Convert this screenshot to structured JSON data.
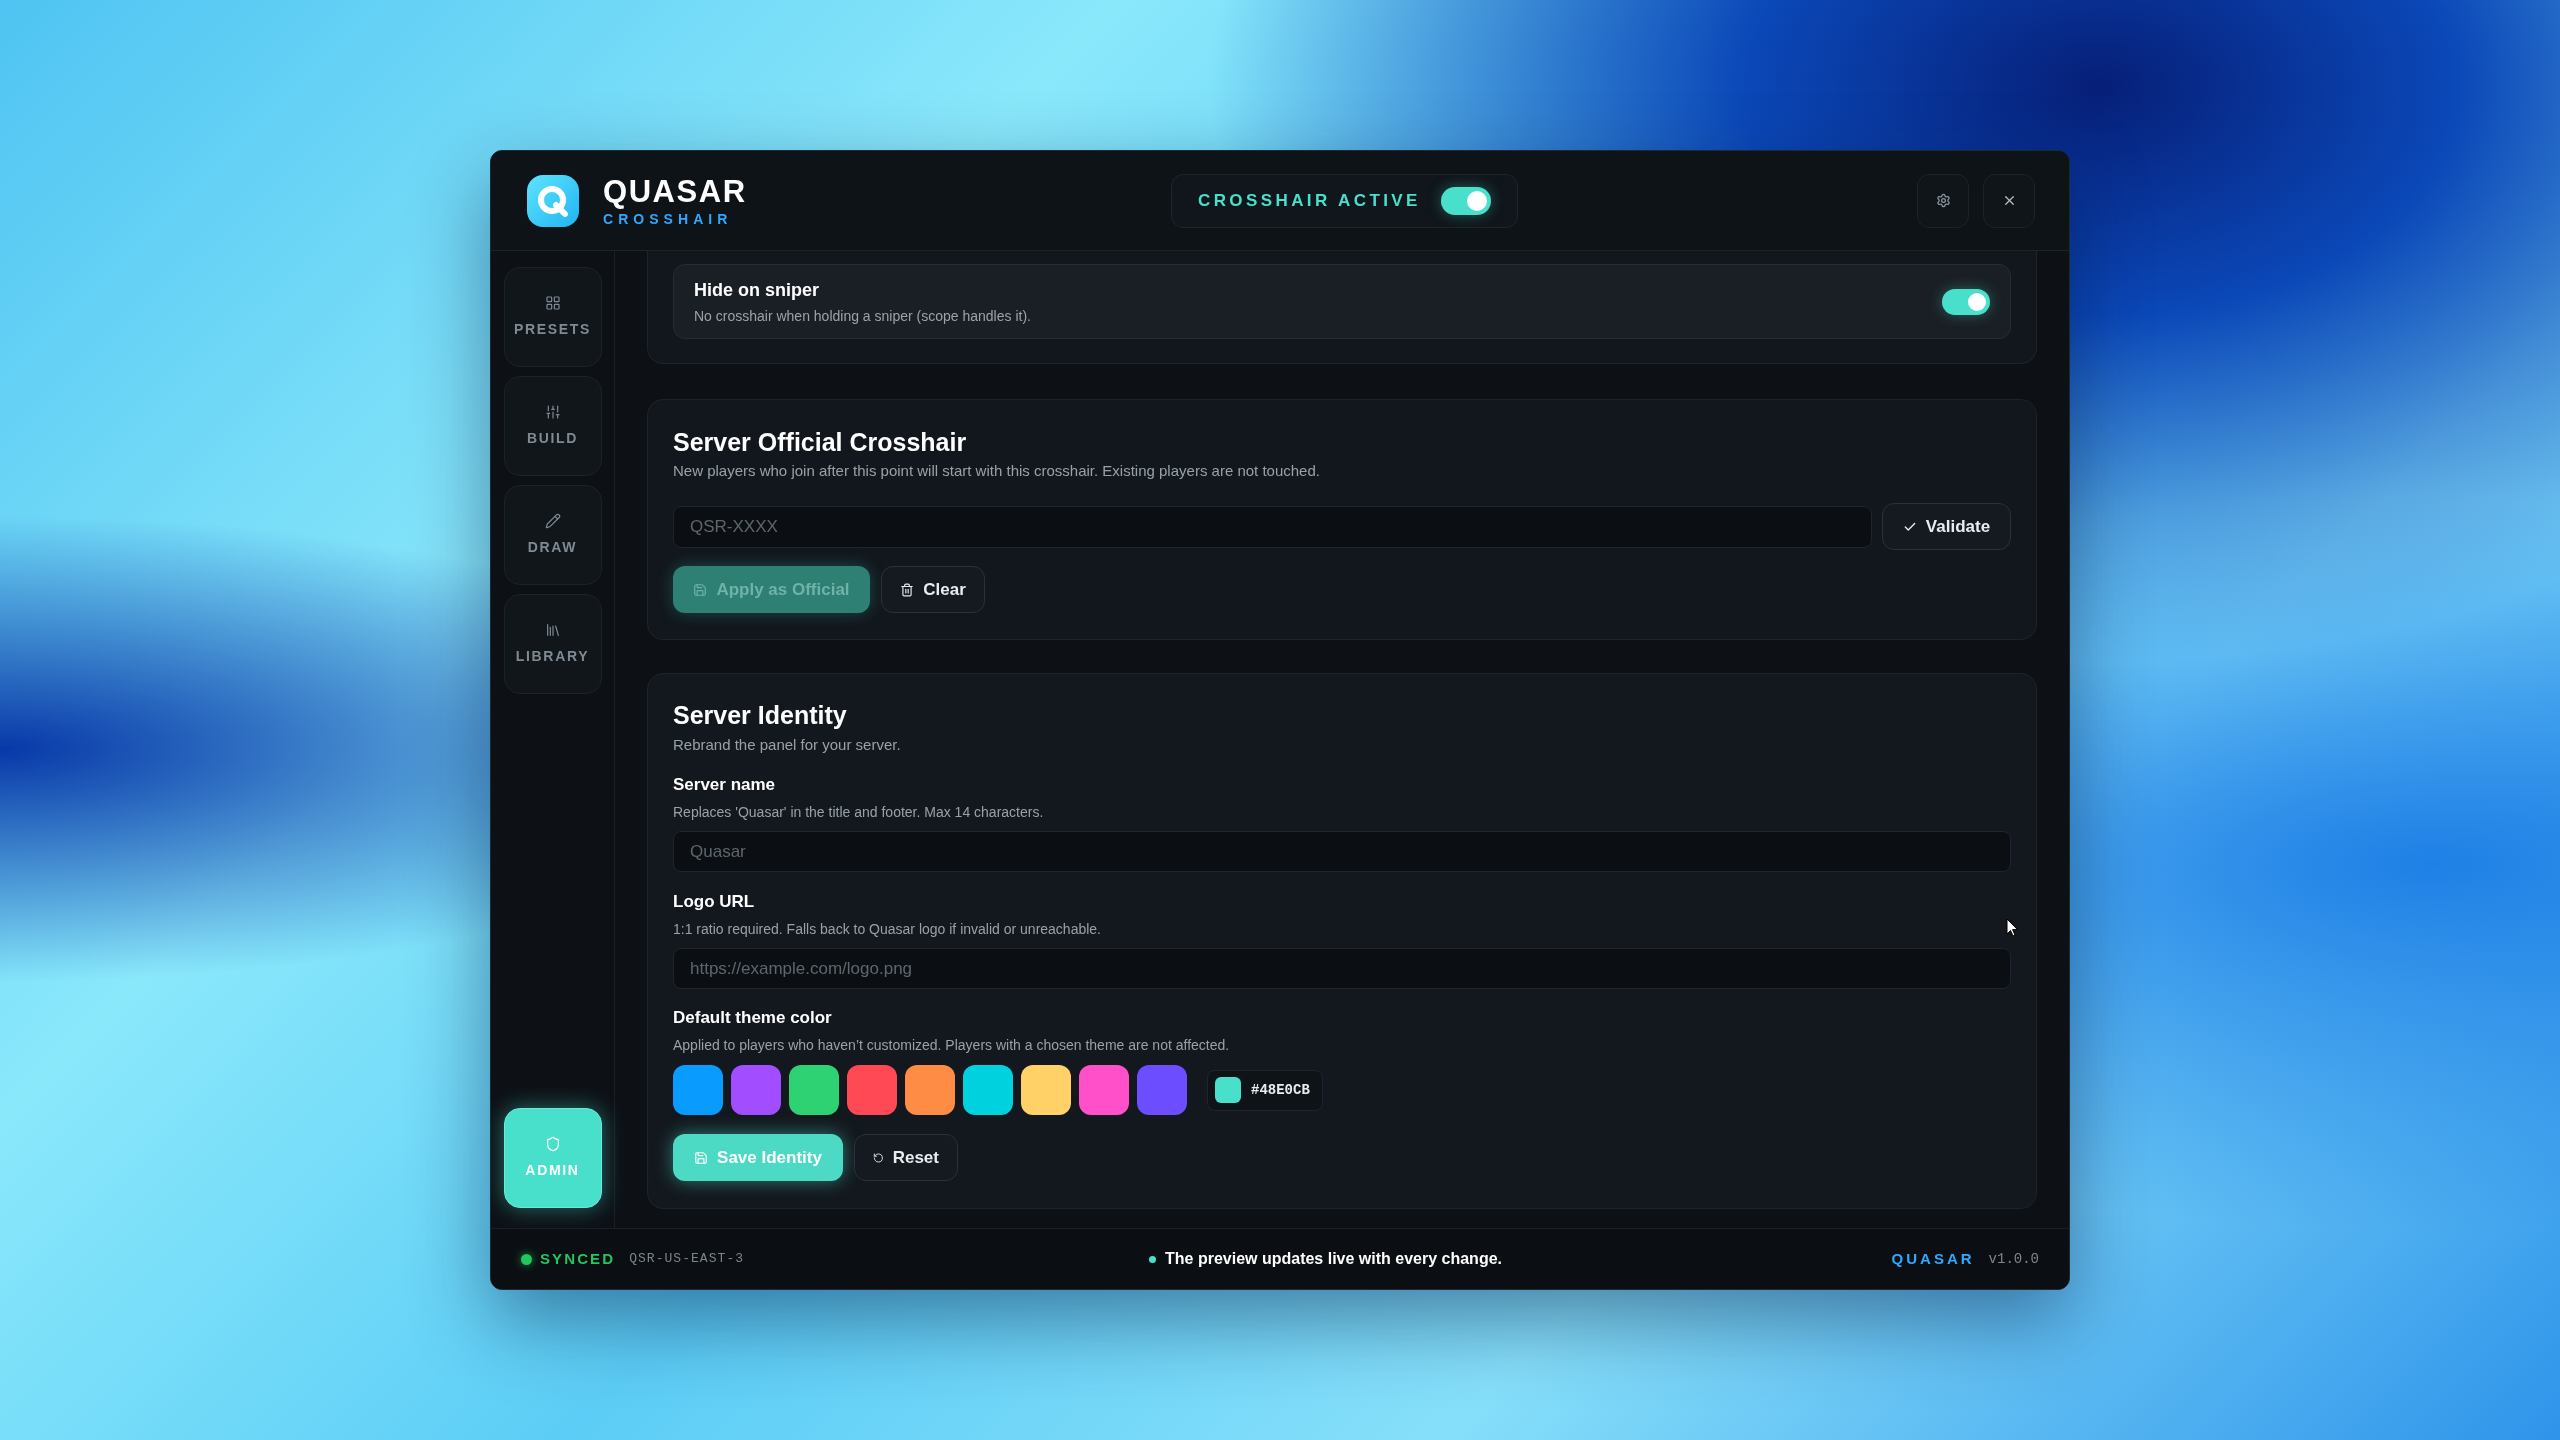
{
  "header": {
    "title": "QUASAR",
    "subtitle": "CROSSHAIR",
    "crosshair_toggle": {
      "label": "CROSSHAIR ACTIVE",
      "on": true
    }
  },
  "sidebar": {
    "items": [
      {
        "label": "PRESETS",
        "selected": false
      },
      {
        "label": "BUILD",
        "selected": false
      },
      {
        "label": "DRAW",
        "selected": false
      },
      {
        "label": "LIBRARY",
        "selected": false
      }
    ],
    "admin": {
      "label": "ADMIN",
      "selected": true
    }
  },
  "sniper_setting": {
    "title": "Hide on sniper",
    "description": "No crosshair when holding a sniper (scope handles it).",
    "on": true
  },
  "official_crosshair": {
    "title": "Server Official Crosshair",
    "description": "New players who join after this point will start with this crosshair. Existing players are not touched.",
    "code_field": {
      "placeholder": "QSR-XXXX"
    },
    "validate_button": "Validate",
    "apply_button": {
      "label": "Apply as Official",
      "disabled": true
    },
    "clear_button": "Clear"
  },
  "server_identity": {
    "title": "Server Identity",
    "description": "Rebrand the panel for your server.",
    "fields": [
      {
        "label": "Server name",
        "hint": "Replaces 'Quasar' in the title and footer. Max 14 characters.",
        "placeholder": "Quasar"
      },
      {
        "label": "Logo URL",
        "hint": "1:1 ratio required. Falls back to Quasar logo if invalid or unreachable.",
        "placeholder": "https://example.com/logo.png"
      }
    ],
    "theme": {
      "label": "Default theme color",
      "hint": "Applied to players who haven’t customized. Players with a chosen theme are not affected.",
      "swatches": [
        {
          "color": "#0a9bff",
          "selected": false
        },
        {
          "color": "#a24dff",
          "selected": false
        },
        {
          "color": "#2ed273",
          "selected": false
        },
        {
          "color": "#ff4a55",
          "selected": false
        },
        {
          "color": "#ff8c45",
          "selected": false
        },
        {
          "color": "#00d1de",
          "selected": false
        },
        {
          "color": "#ffd166",
          "selected": false
        },
        {
          "color": "#ff4fc9",
          "selected": false
        },
        {
          "color": "#6c4dff",
          "selected": false
        }
      ],
      "custom": {
        "color": "#48e0cb",
        "value": "#48E0CB"
      }
    },
    "save_button": "Save Identity",
    "reset_button": "Reset"
  },
  "status_bar": {
    "sync_status": "SYNCED",
    "region": "QSR-US-EAST-3",
    "message": "The preview updates live with every change.",
    "brand": "QUASAR",
    "version": "v1.0.0"
  }
}
